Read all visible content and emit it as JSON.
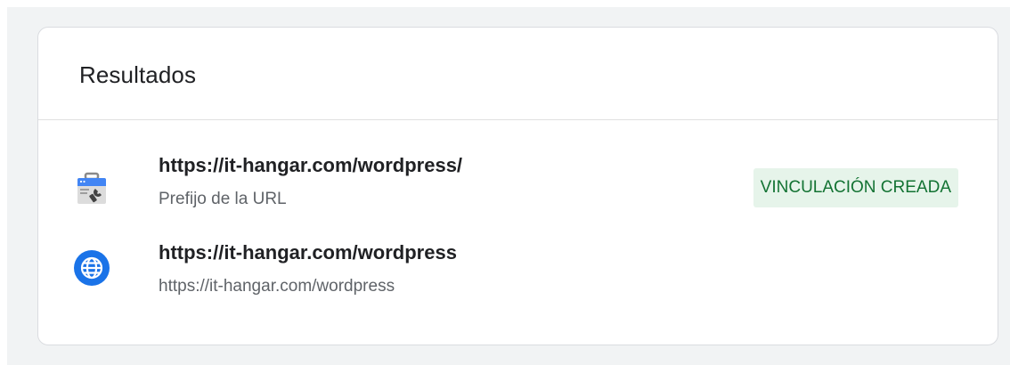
{
  "panel": {
    "title": "Resultados"
  },
  "results": [
    {
      "icon": "search-console-toolbox-icon",
      "main": "https://it-hangar.com/wordpress/",
      "sub": "Prefijo de la URL",
      "status": "VINCULACIÓN CREADA",
      "status_color": "#137333",
      "status_bg": "#e6f4ea"
    },
    {
      "icon": "globe-icon",
      "main": "https://it-hangar.com/wordpress",
      "sub": "https://it-hangar.com/wordpress",
      "icon_color": "#1a73e8"
    }
  ]
}
